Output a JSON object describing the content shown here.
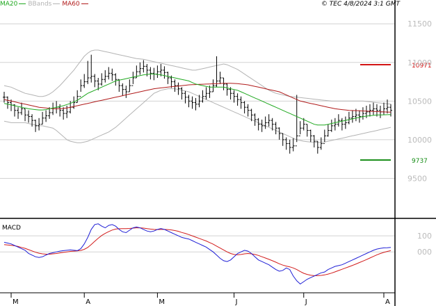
{
  "header": {
    "legend": [
      {
        "label": "MA20",
        "color": "#1fa81f"
      },
      {
        "label": "BBands",
        "color": "#b4b4b4"
      },
      {
        "label": "MA60",
        "color": "#b01a1a"
      }
    ],
    "copyright": "© TEC 4/8/2024 3:1 GMT"
  },
  "colors": {
    "price": "#000000",
    "ma20": "#1fa81f",
    "ma60": "#b01a1a",
    "bbands": "#b4b4b4",
    "macd": "#1f1fd6",
    "signal": "#d21c1c",
    "grid": "#d2d2d2",
    "axis": "#000000",
    "resistance": "#d21414",
    "support": "#148c14"
  },
  "chart_data": [
    {
      "type": "line",
      "title": "",
      "ylim": [
        9000,
        11700
      ],
      "yticks": [
        9500,
        10000,
        10500,
        11000
      ],
      "ytick_labels": [
        "9500",
        "10000",
        "10500",
        "11000",
        "11500"
      ],
      "ytick_values": [
        9500,
        10000,
        10500,
        11000,
        11500
      ],
      "xlabels": [
        {
          "label": "M",
          "index": 2
        },
        {
          "label": "A",
          "index": 23
        },
        {
          "label": "M",
          "index": 44
        },
        {
          "label": "J",
          "index": 66
        },
        {
          "label": "J",
          "index": 86
        },
        {
          "label": "A",
          "index": 109
        }
      ],
      "n": 112,
      "price": [
        10550,
        10480,
        10450,
        10380,
        10350,
        10400,
        10320,
        10300,
        10250,
        10180,
        10200,
        10280,
        10310,
        10350,
        10400,
        10420,
        10380,
        10340,
        10360,
        10420,
        10480,
        10560,
        10700,
        10750,
        10800,
        10820,
        10760,
        10720,
        10780,
        10820,
        10860,
        10840,
        10780,
        10700,
        10650,
        10620,
        10700,
        10800,
        10880,
        10920,
        10950,
        10900,
        10860,
        10850,
        10880,
        10900,
        10870,
        10800,
        10750,
        10700,
        10660,
        10600,
        10550,
        10500,
        10480,
        10460,
        10500,
        10560,
        10600,
        10620,
        10700,
        10760,
        10800,
        10720,
        10650,
        10600,
        10560,
        10520,
        10480,
        10420,
        10380,
        10320,
        10260,
        10200,
        10180,
        10220,
        10250,
        10200,
        10150,
        10080,
        10000,
        9950,
        9900,
        9920,
        10050,
        10150,
        10200,
        10120,
        10050,
        9980,
        9900,
        9950,
        10050,
        10120,
        10180,
        10200,
        10250,
        10200,
        10220,
        10280,
        10300,
        10320,
        10300,
        10340,
        10360,
        10380,
        10400,
        10380,
        10360,
        10400,
        10420,
        10380
      ],
      "hi": [
        10620,
        10560,
        10520,
        10460,
        10420,
        10480,
        10400,
        10380,
        10330,
        10260,
        10280,
        10360,
        10380,
        10420,
        10480,
        10500,
        10460,
        10420,
        10440,
        10500,
        10560,
        10640,
        10780,
        10850,
        11020,
        11100,
        10850,
        10800,
        10860,
        10900,
        10940,
        10920,
        10860,
        10780,
        10730,
        10700,
        10780,
        10880,
        10960,
        11000,
        11030,
        10980,
        10940,
        10930,
        10960,
        10980,
        10950,
        10880,
        10830,
        10780,
        10740,
        10680,
        10630,
        10580,
        10560,
        10540,
        10580,
        10640,
        10680,
        10700,
        10780,
        11080,
        10880,
        10800,
        10730,
        10680,
        10640,
        10600,
        10560,
        10500,
        10460,
        10400,
        10340,
        10280,
        10260,
        10300,
        10330,
        10280,
        10230,
        10160,
        10080,
        10030,
        10000,
        10020,
        10580,
        10240,
        10280,
        10200,
        10130,
        10060,
        9980,
        10030,
        10130,
        10200,
        10260,
        10280,
        10330,
        10280,
        10300,
        10360,
        10380,
        10400,
        10380,
        10420,
        10440,
        10460,
        10480,
        10460,
        10440,
        10480,
        10520,
        10460
      ],
      "lo": [
        10480,
        10400,
        10370,
        10300,
        10270,
        10320,
        10240,
        10220,
        10170,
        10100,
        10120,
        10200,
        10230,
        10270,
        10320,
        10340,
        10300,
        10260,
        10280,
        10340,
        10400,
        10480,
        10620,
        10670,
        10720,
        10740,
        10680,
        10640,
        10700,
        10740,
        10780,
        10760,
        10700,
        10620,
        10570,
        10540,
        10620,
        10720,
        10800,
        10840,
        10870,
        10820,
        10780,
        10770,
        10800,
        10820,
        10790,
        10720,
        10670,
        10620,
        10580,
        10520,
        10470,
        10420,
        10400,
        10380,
        10420,
        10480,
        10520,
        10540,
        10620,
        10680,
        10720,
        10640,
        10570,
        10520,
        10480,
        10440,
        10400,
        10340,
        10300,
        10240,
        10180,
        10120,
        10100,
        10140,
        10170,
        10120,
        10070,
        10000,
        9920,
        9870,
        9820,
        9850,
        9970,
        10070,
        10120,
        10040,
        9970,
        9900,
        9820,
        9870,
        9970,
        10040,
        10100,
        10120,
        10170,
        10120,
        10140,
        10200,
        10220,
        10240,
        10220,
        10260,
        10280,
        10300,
        10320,
        10300,
        10280,
        10320,
        10340,
        10300
      ],
      "ma20": [
        10470,
        10460,
        10450,
        10440,
        10430,
        10420,
        10410,
        10400,
        10395,
        10390,
        10385,
        10385,
        10390,
        10400,
        10410,
        10420,
        10430,
        10440,
        10455,
        10470,
        10490,
        10510,
        10540,
        10570,
        10600,
        10620,
        10640,
        10660,
        10680,
        10700,
        10720,
        10740,
        10760,
        10770,
        10780,
        10790,
        10800,
        10810,
        10820,
        10830,
        10840,
        10845,
        10850,
        10850,
        10845,
        10840,
        10830,
        10820,
        10810,
        10800,
        10790,
        10780,
        10770,
        10760,
        10740,
        10720,
        10710,
        10700,
        10690,
        10680,
        10680,
        10680,
        10680,
        10680,
        10670,
        10660,
        10650,
        10640,
        10620,
        10600,
        10580,
        10560,
        10540,
        10520,
        10500,
        10480,
        10460,
        10440,
        10420,
        10400,
        10380,
        10360,
        10340,
        10320,
        10300,
        10280,
        10260,
        10240,
        10220,
        10200,
        10190,
        10190,
        10190,
        10200,
        10210,
        10220,
        10230,
        10240,
        10250,
        10260,
        10270,
        10280,
        10290,
        10300,
        10305,
        10310,
        10315,
        10320,
        10320,
        10322,
        10324,
        10325
      ],
      "ma60": [
        10520,
        10510,
        10500,
        10490,
        10480,
        10470,
        10460,
        10450,
        10440,
        10430,
        10420,
        10415,
        10410,
        10405,
        10400,
        10400,
        10400,
        10405,
        10410,
        10420,
        10430,
        10440,
        10450,
        10460,
        10470,
        10480,
        10490,
        10500,
        10510,
        10520,
        10530,
        10540,
        10550,
        10560,
        10570,
        10580,
        10590,
        10600,
        10610,
        10620,
        10630,
        10640,
        10650,
        10660,
        10665,
        10670,
        10675,
        10680,
        10685,
        10690,
        10695,
        10700,
        10705,
        10710,
        10712,
        10714,
        10716,
        10718,
        10720,
        10722,
        10724,
        10726,
        10728,
        10730,
        10730,
        10730,
        10728,
        10725,
        10720,
        10715,
        10710,
        10700,
        10690,
        10680,
        10670,
        10660,
        10650,
        10640,
        10630,
        10620,
        10600,
        10580,
        10560,
        10540,
        10520,
        10500,
        10490,
        10480,
        10470,
        10460,
        10450,
        10440,
        10430,
        10420,
        10410,
        10400,
        10395,
        10390,
        10385,
        10380,
        10378,
        10376,
        10374,
        10372,
        10370,
        10368,
        10366,
        10364,
        10362,
        10360,
        10358,
        10356
      ],
      "bb_upper": [
        10700,
        10690,
        10680,
        10660,
        10640,
        10620,
        10600,
        10590,
        10580,
        10570,
        10560,
        10560,
        10570,
        10590,
        10620,
        10660,
        10700,
        10750,
        10800,
        10850,
        10900,
        10960,
        11020,
        11080,
        11120,
        11150,
        11160,
        11160,
        11150,
        11140,
        11130,
        11120,
        11110,
        11100,
        11090,
        11080,
        11070,
        11060,
        11050,
        11045,
        11040,
        11030,
        11020,
        11010,
        11000,
        10990,
        10980,
        10970,
        10960,
        10950,
        10940,
        10930,
        10920,
        10910,
        10900,
        10900,
        10910,
        10920,
        10930,
        10940,
        10950,
        10960,
        10970,
        10980,
        10970,
        10950,
        10930,
        10910,
        10880,
        10850,
        10820,
        10790,
        10760,
        10730,
        10700,
        10670,
        10640,
        10620,
        10600,
        10590,
        10580,
        10570,
        10560,
        10555,
        10550,
        10545,
        10540,
        10535,
        10530,
        10525,
        10520,
        10515,
        10510,
        10505,
        10500,
        10500,
        10500,
        10500,
        10500,
        10500,
        10500,
        10500,
        10500,
        10500,
        10495,
        10490,
        10485,
        10480,
        10475,
        10470,
        10465,
        10460
      ],
      "bb_lower": [
        10240,
        10230,
        10220,
        10220,
        10220,
        10220,
        10220,
        10210,
        10200,
        10190,
        10180,
        10180,
        10170,
        10160,
        10150,
        10120,
        10080,
        10040,
        10000,
        9980,
        9970,
        9960,
        9960,
        9970,
        9980,
        10000,
        10020,
        10040,
        10060,
        10080,
        10100,
        10130,
        10160,
        10200,
        10240,
        10280,
        10320,
        10360,
        10400,
        10440,
        10480,
        10520,
        10560,
        10600,
        10620,
        10640,
        10650,
        10660,
        10660,
        10660,
        10650,
        10640,
        10630,
        10620,
        10600,
        10580,
        10560,
        10540,
        10520,
        10500,
        10480,
        10460,
        10440,
        10420,
        10400,
        10380,
        10360,
        10340,
        10320,
        10300,
        10280,
        10260,
        10240,
        10220,
        10200,
        10180,
        10160,
        10140,
        10120,
        10100,
        10080,
        10060,
        10040,
        10020,
        10000,
        9990,
        9980,
        9975,
        9970,
        9968,
        9966,
        9968,
        9970,
        9980,
        9990,
        10000,
        10010,
        10020,
        10030,
        10040,
        10050,
        10060,
        10070,
        10080,
        10090,
        10100,
        10110,
        10120,
        10130,
        10140,
        10150,
        10160
      ],
      "reference_lines": [
        {
          "label": "10971",
          "value": 10971,
          "color": "#d21414"
        },
        {
          "label": "9737",
          "value": 9737,
          "color": "#148c14"
        }
      ]
    },
    {
      "type": "line",
      "title": "MACD",
      "ylim": [
        -250,
        200
      ],
      "ytick_labels": [
        "100",
        "000"
      ],
      "ytick_values": [
        100,
        0
      ],
      "series": [
        {
          "name": "",
          "values": [
            60,
            55,
            50,
            40,
            30,
            20,
            10,
            -10,
            -20,
            -30,
            -35,
            -30,
            -20,
            -10,
            -5,
            0,
            5,
            8,
            10,
            12,
            10,
            8,
            20,
            50,
            90,
            140,
            170,
            175,
            160,
            150,
            165,
            170,
            160,
            140,
            125,
            120,
            135,
            150,
            155,
            150,
            140,
            130,
            125,
            130,
            140,
            145,
            140,
            130,
            120,
            110,
            100,
            90,
            85,
            80,
            70,
            60,
            50,
            40,
            30,
            15,
            0,
            -20,
            -40,
            -55,
            -60,
            -50,
            -30,
            -10,
            0,
            10,
            5,
            -10,
            -30,
            -50,
            -60,
            -70,
            -80,
            -95,
            -110,
            -120,
            -115,
            -100,
            -110,
            -150,
            -180,
            -200,
            -185,
            -170,
            -160,
            -150,
            -140,
            -130,
            -125,
            -110,
            -100,
            -90,
            -85,
            -80,
            -70,
            -60,
            -50,
            -40,
            -30,
            -20,
            -10,
            0,
            10,
            18,
            22,
            25,
            26,
            28
          ]
        },
        {
          "name": "",
          "values": [
            45,
            43,
            41,
            38,
            34,
            28,
            22,
            14,
            6,
            -2,
            -8,
            -12,
            -14,
            -14,
            -12,
            -10,
            -6,
            -3,
            0,
            3,
            5,
            6,
            9,
            16,
            28,
            46,
            66,
            85,
            102,
            115,
            126,
            136,
            142,
            144,
            145,
            145,
            146,
            148,
            150,
            150,
            148,
            145,
            142,
            140,
            139,
            140,
            140,
            139,
            137,
            133,
            128,
            121,
            115,
            108,
            100,
            92,
            84,
            76,
            68,
            58,
            48,
            36,
            24,
            12,
            0,
            -10,
            -16,
            -18,
            -16,
            -12,
            -10,
            -12,
            -16,
            -22,
            -30,
            -38,
            -46,
            -55,
            -64,
            -74,
            -82,
            -88,
            -93,
            -100,
            -110,
            -122,
            -133,
            -140,
            -145,
            -148,
            -148,
            -146,
            -143,
            -138,
            -132,
            -124,
            -116,
            -108,
            -100,
            -92,
            -84,
            -75,
            -66,
            -57,
            -48,
            -38,
            -28,
            -18,
            -10,
            -3,
            3,
            8
          ]
        }
      ]
    }
  ]
}
